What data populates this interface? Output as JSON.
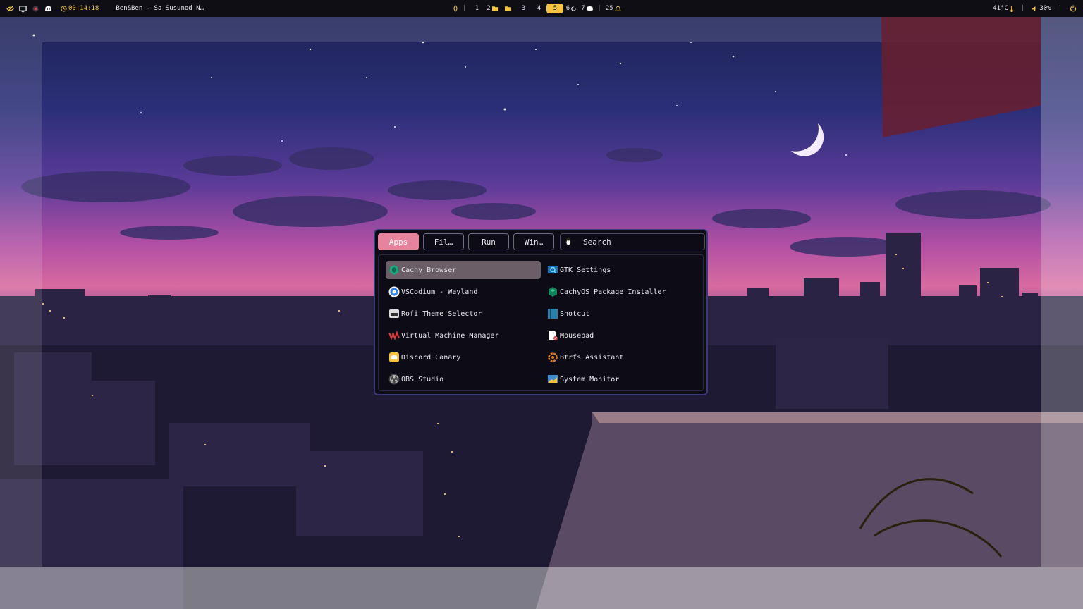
{
  "topbar": {
    "clock": "00:14:18",
    "media": "Ben&Ben - Sa Susunod N…",
    "workspaces": [
      {
        "label": "1",
        "active": false,
        "icon": ""
      },
      {
        "label": "2",
        "active": false,
        "icon": "folder-icon"
      },
      {
        "label": "3",
        "active": false,
        "icon": ""
      },
      {
        "label": "4",
        "active": false,
        "icon": ""
      },
      {
        "label": "5",
        "active": true,
        "icon": ""
      },
      {
        "label": "6",
        "active": false,
        "icon": ""
      },
      {
        "label": "7",
        "active": false,
        "icon": "discord-icon"
      }
    ],
    "notifications": "25",
    "temperature": "41°C",
    "volume": "30%",
    "accent": "#f5c542"
  },
  "launcher": {
    "tabs": [
      {
        "label": "Apps",
        "active": true
      },
      {
        "label": "Fil…",
        "active": false
      },
      {
        "label": "Run",
        "active": false
      },
      {
        "label": "Win…",
        "active": false
      }
    ],
    "search_label": "Search",
    "accent": "#e7849d",
    "items": [
      {
        "label": "Cachy Browser",
        "icon": "cachy-browser-icon",
        "selected": true
      },
      {
        "label": "GTK Settings",
        "icon": "gtk-settings-icon",
        "selected": false
      },
      {
        "label": "VSCodium - Wayland",
        "icon": "vscodium-icon",
        "selected": false
      },
      {
        "label": "CachyOS Package Installer",
        "icon": "package-installer-icon",
        "selected": false
      },
      {
        "label": "Rofi Theme Selector",
        "icon": "rofi-icon",
        "selected": false
      },
      {
        "label": "Shotcut",
        "icon": "shotcut-icon",
        "selected": false
      },
      {
        "label": "Virtual Machine Manager",
        "icon": "vmm-icon",
        "selected": false
      },
      {
        "label": "Mousepad",
        "icon": "mousepad-icon",
        "selected": false
      },
      {
        "label": "Discord Canary",
        "icon": "discord-canary-icon",
        "selected": false
      },
      {
        "label": "Btrfs Assistant",
        "icon": "btrfs-icon",
        "selected": false
      },
      {
        "label": "OBS Studio",
        "icon": "obs-icon",
        "selected": false
      },
      {
        "label": "System Monitor",
        "icon": "system-monitor-icon",
        "selected": false
      }
    ]
  }
}
